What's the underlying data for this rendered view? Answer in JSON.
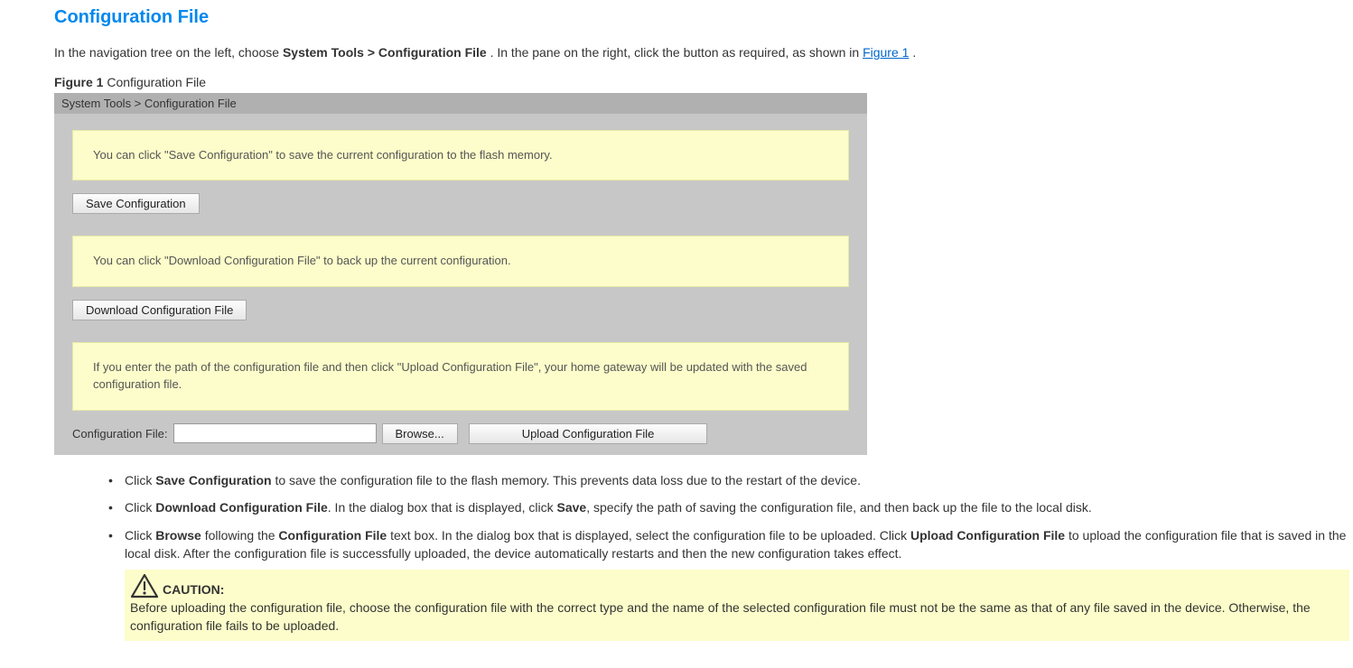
{
  "title": "Configuration File",
  "intro": {
    "prefix": "In the navigation tree on the left, choose ",
    "location_menu": "System Tools",
    "sep": " > ",
    "location_item": "Configuration File",
    "middle": ". In the pane on the right, click the button as required, as shown in ",
    "fig_link_text": "Figure 1",
    "suffix": "."
  },
  "figure": {
    "label": "Figure 1",
    "caption": " Configuration File"
  },
  "panel": {
    "breadcrumb": "System Tools > Configuration File",
    "note_save": "You can click \"Save Configuration\" to save the current configuration to the flash memory.",
    "btn_save": "Save Configuration",
    "note_download": "You can click \"Download Configuration File\" to back up the current configuration.",
    "btn_download": "Download Configuration File",
    "note_upload": "If you enter the path of the configuration file and then click \"Upload Configuration File\", your home gateway will be updated with the saved configuration file.",
    "cfg_label": "Configuration File:",
    "btn_browse": "Browse...",
    "btn_upload": "Upload Configuration File"
  },
  "bullets": [
    {
      "pre": "Click ",
      "b1": "Save Configuration",
      "post": " to save the configuration file to the flash memory. This prevents data loss due to the restart of the device."
    },
    {
      "pre": "Click ",
      "b1": "Download Configuration File",
      "mid1": ". In the dialog box that is displayed, click ",
      "b2": "Save",
      "post": ", specify the path of saving the configuration file, and then back up the file to the local disk."
    },
    {
      "pre": "Click ",
      "b1": "Browse",
      "mid1": " following the ",
      "b2": "Configuration File",
      "mid2": " text box. In the dialog box that is displayed, select the configuration file to be uploaded. Click ",
      "b3": "Upload Configuration File",
      "post": " to upload the configuration file that is saved in the local disk. After the configuration file is successfully uploaded, the device automatically restarts and then the new configuration takes effect."
    }
  ],
  "caution": {
    "heading": "CAUTION:",
    "text": "Before uploading the configuration file, choose the configuration file with the correct type and the name of the selected configuration file must not be the same as that of any file saved in the device. Otherwise, the configuration file fails to be uploaded."
  }
}
